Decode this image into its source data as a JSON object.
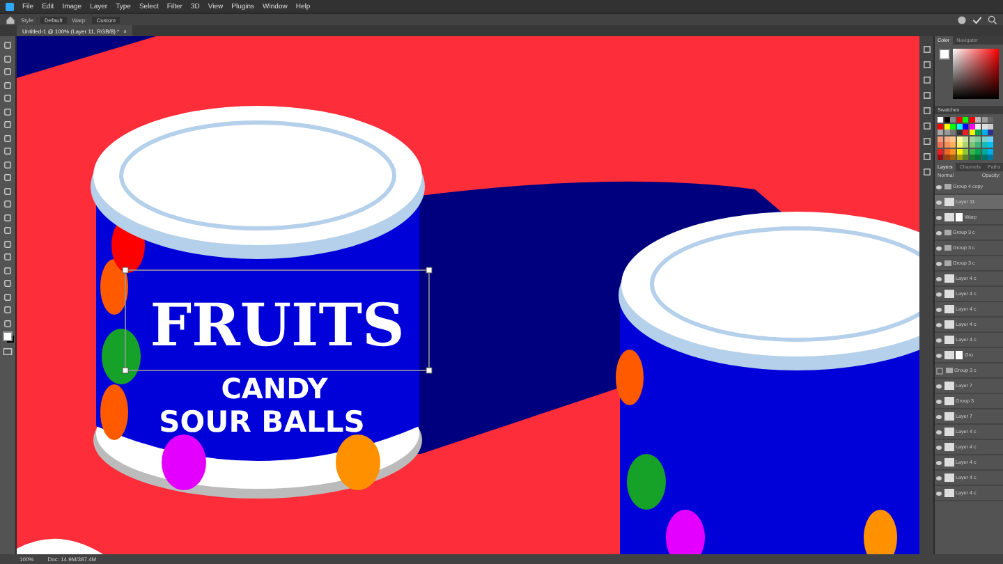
{
  "menu": [
    "File",
    "Edit",
    "Image",
    "Layer",
    "Type",
    "Select",
    "Filter",
    "3D",
    "View",
    "Plugins",
    "Window",
    "Help"
  ],
  "options": {
    "style_label": "Style:",
    "style_value": "Default",
    "warp_label": "Warp:",
    "warp_value": "Custom"
  },
  "document_tab": {
    "title": "Untitled-1 @ 100% (Layer 11, RGB/8) *",
    "close": "×"
  },
  "artwork": {
    "headline": "FRUITS",
    "line_2": "CANDY",
    "line_3": "SOUR BALLS"
  },
  "panels": {
    "color_tabs": [
      {
        "label": "Color",
        "selected": true
      },
      {
        "label": "Navigator",
        "selected": false
      }
    ],
    "swatches_title": "Swatches",
    "swatches": [
      {
        "color": "#ffffff"
      },
      {
        "color": "#000000"
      },
      {
        "color": "#888888"
      },
      {
        "color": "#ff0000"
      },
      {
        "color": "#00ff00"
      },
      {
        "color": "#ff0000"
      },
      {
        "color": "#bbbbbb"
      },
      {
        "color": "#999999"
      },
      {
        "color": "#666666"
      },
      {
        "color": "#ff0000"
      },
      {
        "color": "#ffff00"
      },
      {
        "color": "#00ff00"
      },
      {
        "color": "#00ffff"
      },
      {
        "color": "#0000ff"
      },
      {
        "color": "#ff00ff"
      },
      {
        "color": "#eeeeee"
      },
      {
        "color": "#dddddd"
      },
      {
        "color": "#cccccc"
      },
      {
        "color": "#aaaaaa"
      },
      {
        "color": "#999999"
      },
      {
        "color": "#777777"
      },
      {
        "color": "#333333"
      },
      {
        "color": "#ee1c24"
      },
      {
        "color": "#fff200"
      },
      {
        "color": "#00a651"
      },
      {
        "color": "#00aeef"
      },
      {
        "color": "#2e3192"
      },
      {
        "color": "#f7977a"
      },
      {
        "color": "#fbad82"
      },
      {
        "color": "#fdc68c"
      },
      {
        "color": "#fff799"
      },
      {
        "color": "#c6df9c"
      },
      {
        "color": "#a4d49d"
      },
      {
        "color": "#81ca9d"
      },
      {
        "color": "#7bcdc8"
      },
      {
        "color": "#6ccff7"
      },
      {
        "color": "#f26c4f"
      },
      {
        "color": "#f68e55"
      },
      {
        "color": "#fbaf5c"
      },
      {
        "color": "#fff467"
      },
      {
        "color": "#acd372"
      },
      {
        "color": "#7dc473"
      },
      {
        "color": "#39b778"
      },
      {
        "color": "#16bcb4"
      },
      {
        "color": "#00bff3"
      },
      {
        "color": "#ed1c24"
      },
      {
        "color": "#f26522"
      },
      {
        "color": "#f7941d"
      },
      {
        "color": "#fff200"
      },
      {
        "color": "#8dc63f"
      },
      {
        "color": "#39b54a"
      },
      {
        "color": "#00a651"
      },
      {
        "color": "#00a99d"
      },
      {
        "color": "#00aeef"
      },
      {
        "color": "#9e0b0f"
      },
      {
        "color": "#a0410d"
      },
      {
        "color": "#a3620a"
      },
      {
        "color": "#aba000"
      },
      {
        "color": "#598527"
      },
      {
        "color": "#1a7b30"
      },
      {
        "color": "#007236"
      },
      {
        "color": "#00746b"
      },
      {
        "color": "#0076a3"
      }
    ],
    "layer_tabs": [
      {
        "label": "Layers",
        "selected": true
      },
      {
        "label": "Channels",
        "selected": false
      },
      {
        "label": "Paths",
        "selected": false
      }
    ],
    "blend_mode": "Normal",
    "opacity_label": "Opacity:",
    "layers": [
      {
        "name": "Group 4 copy",
        "kind": "group",
        "visible": true,
        "selected": false
      },
      {
        "name": "Layer 11",
        "kind": "layer",
        "visible": true,
        "selected": true
      },
      {
        "name": "Warp",
        "kind": "masked",
        "visible": true,
        "selected": false
      },
      {
        "name": "Group 3 c",
        "kind": "group",
        "visible": true,
        "selected": false
      },
      {
        "name": "Group 3 c",
        "kind": "group",
        "visible": true,
        "selected": false
      },
      {
        "name": "Group 3 c",
        "kind": "group",
        "visible": true,
        "selected": false
      },
      {
        "name": "Layer 4 c",
        "kind": "layer",
        "visible": true,
        "selected": false
      },
      {
        "name": "Layer 4 c",
        "kind": "layer",
        "visible": true,
        "selected": false
      },
      {
        "name": "Layer 4 c",
        "kind": "layer",
        "visible": true,
        "selected": false
      },
      {
        "name": "Layer 4 c",
        "kind": "layer",
        "visible": true,
        "selected": false
      },
      {
        "name": "Layer 4 c",
        "kind": "layer",
        "visible": true,
        "selected": false
      },
      {
        "name": "Gro",
        "kind": "masked",
        "visible": true,
        "selected": false
      },
      {
        "name": "Group 3 c",
        "kind": "group",
        "visible": false,
        "selected": false
      },
      {
        "name": "Layer 7",
        "kind": "layer",
        "visible": true,
        "selected": false
      },
      {
        "name": "Group 3",
        "kind": "layer",
        "visible": true,
        "selected": false
      },
      {
        "name": "Layer 7",
        "kind": "layer",
        "visible": true,
        "selected": false
      },
      {
        "name": "Layer 4 c",
        "kind": "layer",
        "visible": true,
        "selected": false
      },
      {
        "name": "Layer 4 c",
        "kind": "layer",
        "visible": true,
        "selected": false
      },
      {
        "name": "Layer 4 c",
        "kind": "layer",
        "visible": true,
        "selected": false
      },
      {
        "name": "Layer 4 c",
        "kind": "layer",
        "visible": true,
        "selected": false
      },
      {
        "name": "Layer 4 c",
        "kind": "layer",
        "visible": true,
        "selected": false
      }
    ]
  },
  "status": {
    "zoom": "100%",
    "doc": "Doc: 14.9M/387.4M"
  }
}
